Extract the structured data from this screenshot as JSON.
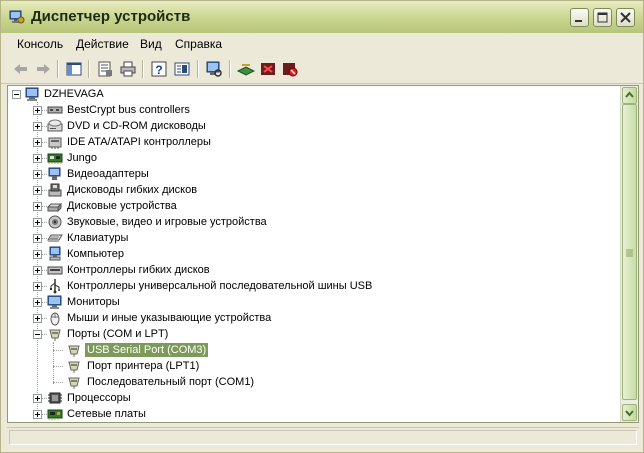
{
  "window": {
    "title": "Диспетчер устройств",
    "controls": [
      "minimize",
      "maximize",
      "close"
    ]
  },
  "menu": [
    "Консоль",
    "Действие",
    "Вид",
    "Справка"
  ],
  "toolbar": [
    "back-icon",
    "forward-icon",
    "console-tree-icon",
    "properties-icon",
    "print-icon",
    "help-icon",
    "show-hide-icon",
    "scan-hardware-icon",
    "update-driver-icon",
    "uninstall-icon",
    "disable-icon"
  ],
  "tree": {
    "root": "DZHEVAGA",
    "items": [
      {
        "label": "BestCrypt bus controllers",
        "icon": "bus-controller-icon",
        "expanded": false
      },
      {
        "label": "DVD и CD-ROM дисководы",
        "icon": "cdrom-icon",
        "expanded": false
      },
      {
        "label": "IDE ATA/ATAPI контроллеры",
        "icon": "ide-controller-icon",
        "expanded": false
      },
      {
        "label": "Jungo",
        "icon": "jungo-board-icon",
        "expanded": false
      },
      {
        "label": "Видеоадаптеры",
        "icon": "display-adapter-icon",
        "expanded": false
      },
      {
        "label": "Дисководы гибких дисков",
        "icon": "floppy-icon",
        "expanded": false
      },
      {
        "label": "Дисковые устройства",
        "icon": "disk-drive-icon",
        "expanded": false
      },
      {
        "label": "Звуковые, видео и игровые устройства",
        "icon": "sound-icon",
        "expanded": false
      },
      {
        "label": "Клавиатуры",
        "icon": "keyboard-icon",
        "expanded": false
      },
      {
        "label": "Компьютер",
        "icon": "computer-icon",
        "expanded": false
      },
      {
        "label": "Контроллеры гибких дисков",
        "icon": "floppy-controller-icon",
        "expanded": false
      },
      {
        "label": "Контроллеры универсальной последовательной шины USB",
        "icon": "usb-icon",
        "expanded": false
      },
      {
        "label": "Мониторы",
        "icon": "monitor-icon",
        "expanded": false
      },
      {
        "label": "Мыши и иные указывающие устройства",
        "icon": "mouse-icon",
        "expanded": false
      },
      {
        "label": "Порты (COM и LPT)",
        "icon": "port-icon",
        "expanded": true,
        "children": [
          {
            "label": "USB Serial Port (COM3)",
            "icon": "port-icon",
            "selected": true
          },
          {
            "label": "Порт принтера (LPT1)",
            "icon": "port-icon",
            "selected": false
          },
          {
            "label": "Последовательный порт (COM1)",
            "icon": "port-icon",
            "selected": false
          }
        ]
      },
      {
        "label": "Процессоры",
        "icon": "processor-icon",
        "expanded": false
      },
      {
        "label": "Сетевые платы",
        "icon": "network-card-icon",
        "expanded": false
      }
    ]
  },
  "colors": {
    "selection": "#7d9a5a",
    "titlebar": "#c9d58d",
    "close_button": "#c0392b"
  }
}
